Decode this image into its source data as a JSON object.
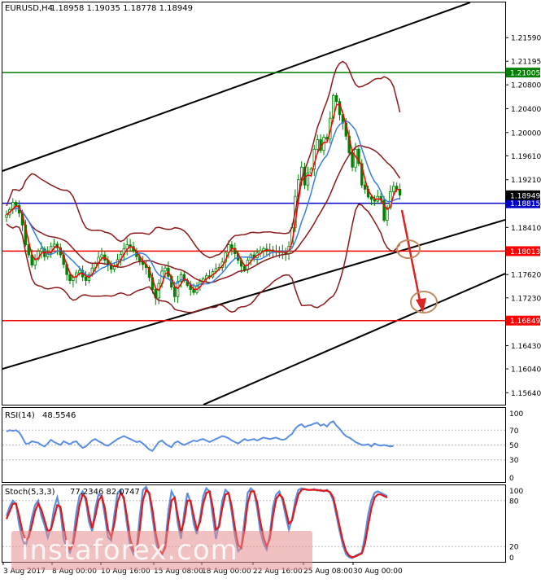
{
  "header": {
    "symbol": "EURUSD,H4",
    "ohlc": "1.18958 1.19035 1.18778 1.18949"
  },
  "watermark": "instaforex.com",
  "chart_data": [
    {
      "type": "candlestick",
      "title": "EURUSD,H4",
      "ylim": [
        1.1544,
        1.2218
      ],
      "y_ticks": [
        "1.21590",
        "1.21195",
        "1.20800",
        "1.20400",
        "1.20000",
        "1.19610",
        "1.19210",
        "1.18815",
        "1.18410",
        "1.18013",
        "1.17620",
        "1.17230",
        "1.16849",
        "1.16430",
        "1.16040",
        "1.15640"
      ],
      "x_ticks": [
        "3 Aug 2017",
        "8 Aug 00:00",
        "10 Aug 16:00",
        "15 Aug 08:00",
        "18 Aug 00:00",
        "22 Aug 16:00",
        "25 Aug 08:00",
        "30 Aug 00:00"
      ],
      "current_price": "1.18949",
      "horizontal_levels": [
        {
          "value": 1.21005,
          "label": "1.21005",
          "color": "#008000"
        },
        {
          "value": 1.18815,
          "label": "1.18815",
          "color": "#0000cc"
        },
        {
          "value": 1.18013,
          "label": "1.18013",
          "color": "#ff0000"
        },
        {
          "value": 1.16849,
          "label": "1.16849",
          "color": "#ff0000"
        }
      ],
      "colors": {
        "candle": "#008000",
        "fast_ma": "#ff0000",
        "slow_ma": "#3a7fe0",
        "bands": "#8b1a1a",
        "channel": "#000000",
        "arrow": "#dd2222",
        "circle": "#c08a60"
      },
      "close": [
        1.1862,
        1.1871,
        1.1883,
        1.1878,
        1.1865,
        1.1845,
        1.1812,
        1.1795,
        1.1778,
        1.1788,
        1.1801,
        1.1805,
        1.1792,
        1.1798,
        1.1809,
        1.1813,
        1.1807,
        1.1795,
        1.1779,
        1.1762,
        1.1752,
        1.1758,
        1.1765,
        1.1769,
        1.1758,
        1.1752,
        1.1762,
        1.1773,
        1.1781,
        1.1791,
        1.1795,
        1.1786,
        1.1778,
        1.1771,
        1.1777,
        1.1787,
        1.1796,
        1.1805,
        1.1812,
        1.1809,
        1.1801,
        1.1792,
        1.1784,
        1.1779,
        1.1774,
        1.1757,
        1.1737,
        1.1723,
        1.1747,
        1.1768,
        1.1773,
        1.1759,
        1.1741,
        1.1725,
        1.1751,
        1.1762,
        1.1752,
        1.1744,
        1.1737,
        1.1732,
        1.1742,
        1.175,
        1.1755,
        1.176,
        1.1758,
        1.1767,
        1.1772,
        1.1774,
        1.1783,
        1.1799,
        1.1812,
        1.1806,
        1.1797,
        1.1786,
        1.1776,
        1.177,
        1.1786,
        1.1795,
        1.179,
        1.1798,
        1.1802,
        1.1805,
        1.1801,
        1.1803,
        1.1801,
        1.1799,
        1.1802,
        1.1799,
        1.1797,
        1.1809,
        1.1841,
        1.1893,
        1.1921,
        1.1942,
        1.1912,
        1.1932,
        1.1939,
        1.1972,
        1.1988,
        1.197,
        1.1992,
        1.1989,
        1.2024,
        1.2062,
        1.2052,
        1.203,
        1.2016,
        1.1994,
        1.1966,
        1.1942,
        1.1972,
        1.1948,
        1.1912,
        1.1905,
        1.1892,
        1.1888,
        1.1885,
        1.1893,
        1.1887,
        1.1853,
        1.1874,
        1.1901,
        1.191,
        1.1905,
        1.1895
      ],
      "indicators": [
        {
          "name": "RSI(14)",
          "value": "48.5546",
          "ylim": [
            0,
            100
          ],
          "levels": [
            "70",
            "50",
            "30"
          ],
          "values": [
            68,
            70,
            69,
            70,
            67,
            60,
            52,
            52,
            55,
            54,
            53,
            50,
            48,
            52,
            57,
            54,
            52,
            50,
            55,
            53,
            51,
            54,
            55,
            50,
            46,
            48,
            52,
            56,
            58,
            55,
            53,
            50,
            49,
            52,
            55,
            58,
            60,
            62,
            60,
            58,
            56,
            54,
            55,
            52,
            48,
            44,
            42,
            48,
            54,
            56,
            52,
            49,
            47,
            53,
            55,
            52,
            50,
            52,
            54,
            56,
            55,
            57,
            58,
            56,
            54,
            56,
            58,
            60,
            62,
            61,
            59,
            56,
            54,
            52,
            55,
            58,
            56,
            57,
            58,
            56,
            58,
            60,
            59,
            58,
            59,
            60,
            58,
            57,
            58,
            62,
            65,
            72,
            76,
            78,
            74,
            76,
            77,
            79,
            80,
            76,
            78,
            75,
            80,
            82,
            76,
            72,
            66,
            62,
            60,
            57,
            54,
            52,
            50,
            50,
            51,
            48,
            52,
            50,
            49,
            50,
            49,
            48,
            49
          ]
        },
        {
          "name": "Stoch(5,3,3)",
          "value": "77.2346 82.0747",
          "ylim": [
            0,
            100
          ],
          "levels": [
            "80",
            "20"
          ],
          "values_main": [
            60,
            72,
            80,
            76,
            48,
            30,
            20,
            35,
            58,
            74,
            80,
            60,
            48,
            32,
            44,
            70,
            84,
            66,
            30,
            18,
            12,
            28,
            64,
            86,
            92,
            80,
            52,
            40,
            70,
            88,
            86,
            60,
            32,
            28,
            62,
            90,
            94,
            80,
            48,
            20,
            10,
            16,
            60,
            94,
            98,
            88,
            58,
            28,
            12,
            8,
            22,
            66,
            92,
            84,
            50,
            30,
            64,
            90,
            78,
            50,
            36,
            58,
            86,
            96,
            92,
            60,
            30,
            50,
            80,
            94,
            90,
            64,
            34,
            14,
            18,
            54,
            90,
            96,
            92,
            70,
            40,
            24,
            16,
            36,
            72,
            88,
            92,
            80,
            60,
            42,
            56,
            80,
            94,
            96,
            95,
            94,
            94,
            95,
            93,
            94,
            92,
            94,
            90,
            80,
            60,
            40,
            22,
            10,
            6,
            5,
            8,
            10,
            12,
            34,
            62,
            80,
            90,
            92,
            90,
            88,
            86
          ],
          "values_signal": [
            56,
            66,
            76,
            76,
            60,
            40,
            28,
            32,
            48,
            66,
            76,
            68,
            54,
            40,
            42,
            58,
            74,
            72,
            46,
            24,
            16,
            22,
            48,
            74,
            88,
            84,
            62,
            44,
            60,
            80,
            86,
            70,
            42,
            32,
            50,
            78,
            90,
            84,
            58,
            30,
            14,
            14,
            42,
            80,
            94,
            90,
            68,
            38,
            18,
            10,
            18,
            50,
            80,
            84,
            60,
            38,
            54,
            80,
            80,
            60,
            42,
            52,
            76,
            90,
            92,
            72,
            42,
            46,
            70,
            88,
            90,
            72,
            44,
            22,
            18,
            42,
            76,
            92,
            92,
            78,
            52,
            32,
            20,
            30,
            60,
            82,
            88,
            84,
            68,
            50,
            54,
            72,
            88,
            94,
            95,
            94,
            94,
            94,
            94,
            93,
            93,
            93,
            91,
            84,
            66,
            46,
            28,
            14,
            8,
            6,
            7,
            9,
            11,
            24,
            48,
            70,
            84,
            88,
            88,
            86,
            84
          ]
        }
      ]
    }
  ]
}
